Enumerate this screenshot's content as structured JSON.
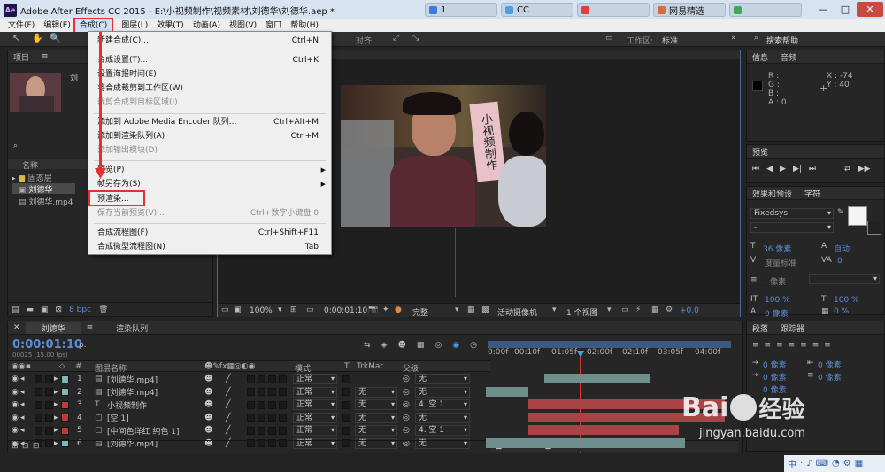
{
  "window": {
    "app_icon": "Ae",
    "title": "Adobe After Effects CC 2015 - E:\\小视频制作\\视频素材\\刘德华\\刘德华.aep *",
    "bg_tabs": [
      {
        "label": "1",
        "color": "#3a7bd5"
      },
      {
        "label": "CC",
        "color": "#4aa0e8"
      },
      {
        "label": "",
        "color": "#d94040"
      },
      {
        "label": "网易精选",
        "color": "#d96a3a"
      },
      {
        "label": "",
        "color": "#3aaa55"
      },
      {
        "label": "",
        "color": "#4a90e0"
      }
    ],
    "minimize": "—",
    "maximize": "□",
    "close": "✕"
  },
  "menubar": {
    "items": [
      "文件(F)",
      "编辑(E)",
      "合成(C)",
      "图层(L)",
      "效果(T)",
      "动画(A)",
      "视图(V)",
      "窗口",
      "帮助(H)"
    ]
  },
  "toolbar": {
    "snap_label": "对齐",
    "workspace_label": "工作区:",
    "workspace_value": "标准",
    "search_label": "搜索帮助"
  },
  "dropdown": {
    "items": [
      {
        "label": "新建合成(C)...",
        "shortcut": "Ctrl+N",
        "disabled": false
      },
      {
        "label": "合成设置(T)...",
        "shortcut": "Ctrl+K",
        "disabled": false
      },
      {
        "label": "设置海报时间(E)",
        "shortcut": "",
        "disabled": false
      },
      {
        "label": "将合成裁剪到工作区(W)",
        "shortcut": "",
        "disabled": false
      },
      {
        "label": "裁剪合成到目标区域(I)",
        "shortcut": "",
        "disabled": true
      },
      {
        "label": "添加到 Adobe Media Encoder 队列...",
        "shortcut": "Ctrl+Alt+M",
        "disabled": false
      },
      {
        "label": "添加到渲染队列(A)",
        "shortcut": "Ctrl+M",
        "disabled": false
      },
      {
        "label": "添加输出模块(D)",
        "shortcut": "",
        "disabled": true
      },
      {
        "label": "预览(P)",
        "shortcut": "",
        "disabled": false
      },
      {
        "label": "帧另存为(S)",
        "shortcut": "",
        "disabled": false
      },
      {
        "label": "预渲染...",
        "shortcut": "",
        "disabled": false
      },
      {
        "label": "保存当前预览(V)...",
        "shortcut": "Ctrl+数字小键盘 0",
        "disabled": true
      },
      {
        "label": "合成流程图(F)",
        "shortcut": "Ctrl+Shift+F11",
        "disabled": false
      },
      {
        "label": "合成微型流程图(N)",
        "shortcut": "Tab",
        "disabled": false
      }
    ]
  },
  "project": {
    "tab": "项目",
    "col_name": "名称",
    "items": [
      "固态层",
      "刘德华",
      "刘德华.mp4"
    ],
    "bpc": "8 bpc",
    "thumb_label": "刘"
  },
  "viewer": {
    "video_sign": "小视频制作",
    "zoom": "100%",
    "timecode": "0:00:01:10",
    "quality": "完整",
    "camera": "活动摄像机",
    "views": "1 个视图",
    "offset": "+0.0"
  },
  "info": {
    "tab1": "信息",
    "tab2": "音频",
    "r": "R :",
    "g": "G :",
    "b": "B :",
    "a": "A : 0",
    "x": "X : -74",
    "y": "Y : 40"
  },
  "preview": {
    "tab": "预览"
  },
  "character": {
    "tab1": "效果和预设",
    "tab2": "字符",
    "font": "Fixedsys",
    "style": "-",
    "size": "36 像素",
    "leading": "自动",
    "tracking": "度量标准",
    "kerning": "0",
    "stroke": "- 像素",
    "scale_v": "100 %",
    "scale_h": "100 %",
    "baseline": "0 像素",
    "tsume": "0 %"
  },
  "paragraph": {
    "tab1": "段落",
    "tab2": "跟踪器",
    "indent_left": "0 像素",
    "indent_right": "0 像素",
    "indent_first": "0 像素",
    "space_before": "0 像素",
    "space_after": "0 像素"
  },
  "timeline": {
    "tab": "刘德华",
    "tab2": "渲染队列",
    "timecode": "0:00:01:10",
    "fps": "00025 (15.00 fps)",
    "search_placeholder": "ρ.",
    "col_layername": "图层名称",
    "col_mode": "模式",
    "col_t": "T",
    "col_trkmat": "TrkMat",
    "col_parent": "父级",
    "ruler": [
      "0:00f",
      "00:10f",
      "01:05f",
      "02:00f",
      "02:10f",
      "03:05f",
      "04:00f"
    ],
    "layers": [
      {
        "num": "1",
        "name": "[刘德华.mp4]",
        "color": "#7fb7b4",
        "mode": "正常",
        "trkmat": "",
        "parent": "无"
      },
      {
        "num": "2",
        "name": "[刘德华.mp4]",
        "color": "#7fb7b4",
        "mode": "正常",
        "trkmat": "无",
        "parent": "无"
      },
      {
        "num": "3",
        "name": "小视频制作",
        "color": "#c0393b",
        "mode": "正常",
        "trkmat": "无",
        "parent": "4. 空 1"
      },
      {
        "num": "4",
        "name": "[空 1]",
        "color": "#c0393b",
        "mode": "正常",
        "trkmat": "无",
        "parent": "无"
      },
      {
        "num": "5",
        "name": "[中间色洋红 纯色 1]",
        "color": "#c0393b",
        "mode": "正常",
        "trkmat": "无",
        "parent": "4. 空 1"
      },
      {
        "num": "6",
        "name": "[刘德华.mp4]",
        "color": "#7fb7b4",
        "mode": "正常",
        "trkmat": "无",
        "parent": "无"
      }
    ]
  },
  "watermark": {
    "brand_en": "Bai",
    "brand_cn": "经验",
    "url": "jingyan.baidu.com"
  },
  "taskbar": {
    "icons": [
      "中",
      "·",
      "♪",
      "⌨",
      "◔",
      "⚙",
      "▦"
    ]
  }
}
